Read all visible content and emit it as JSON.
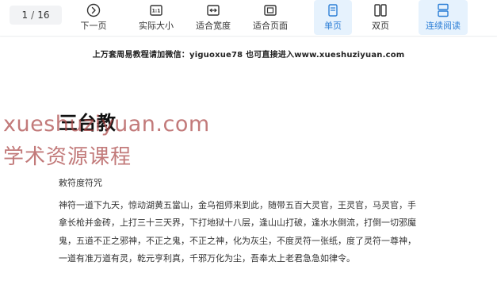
{
  "toolbar": {
    "page_current": "1",
    "page_total": "16",
    "page_sep": "/",
    "buttons": [
      {
        "label": "下一页",
        "icon": "next-page-icon"
      },
      {
        "label": "实际大小",
        "icon": "actual-size-icon"
      },
      {
        "label": "适合宽度",
        "icon": "fit-width-icon"
      },
      {
        "label": "适合页面",
        "icon": "fit-page-icon"
      },
      {
        "label": "单页",
        "icon": "single-page-icon",
        "active": true
      },
      {
        "label": "双页",
        "icon": "double-page-icon"
      },
      {
        "label": "连续阅读",
        "icon": "continuous-read-icon",
        "active": true
      }
    ],
    "accent_color": "#2d7fd6",
    "active_bg": "#e6f2fd"
  },
  "document": {
    "header_note": "上万套周易教程请加微信：yiguoxue78   也可直接进入www.xueshuziyuan.com",
    "title": "三台教",
    "watermark_line1": "xueshuziyuan.com",
    "watermark_line2": "学术资源课程",
    "subheading": "敕符度符咒",
    "body_lines": [
      "神符一道下九天，惊动湖黄五當山，金乌祖师来到此，随带五百大灵官，王灵官，马灵官，手",
      "拿长枪并金砖，上打三十三天界，下打地狱十八层，逢山山打破，逢水水倒流，打倒一切邪魔",
      "鬼，五道不正之邪神，不正之鬼，不正之神，化为灰尘，不度灵符一张纸，度了灵符一尊神，",
      "一道有准万道有灵，乾元亨利真，千邪万化为尘，吾奉太上老君急急如律令。"
    ]
  }
}
